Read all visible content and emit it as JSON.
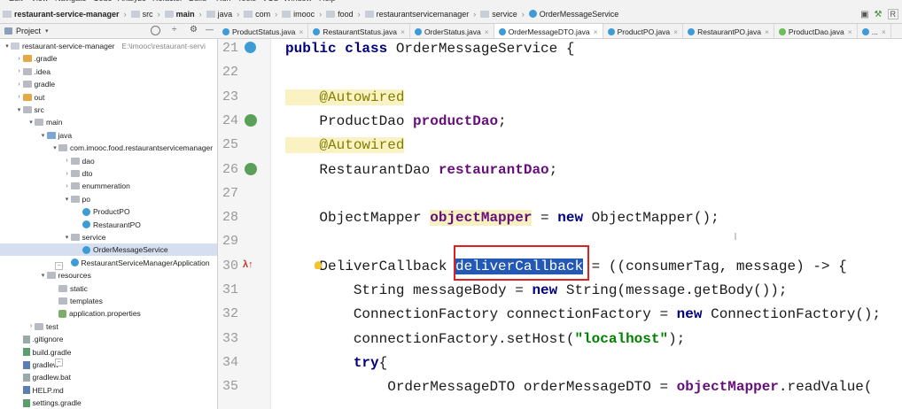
{
  "menubar": {
    "items": [
      "Edit",
      "View",
      "Navigate",
      "Code",
      "Analyze",
      "Refactor",
      "Build",
      "Run",
      "Tools",
      "VCS",
      "Window",
      "Help"
    ]
  },
  "breadcrumb": {
    "items": [
      {
        "label": "restaurant-service-manager",
        "bold": true,
        "icon": "folder"
      },
      {
        "label": "src",
        "bold": false,
        "icon": "folder"
      },
      {
        "label": "main",
        "bold": true,
        "icon": "folder"
      },
      {
        "label": "java",
        "bold": false,
        "icon": "folder"
      },
      {
        "label": "com",
        "bold": false,
        "icon": "folder"
      },
      {
        "label": "imooc",
        "bold": false,
        "icon": "folder"
      },
      {
        "label": "food",
        "bold": false,
        "icon": "folder"
      },
      {
        "label": "restaurantservicemanager",
        "bold": false,
        "icon": "folder"
      },
      {
        "label": "service",
        "bold": false,
        "icon": "folder"
      },
      {
        "label": "OrderMessageService",
        "bold": false,
        "icon": "class"
      }
    ],
    "right_icons": [
      "window-icon",
      "hammer-icon",
      "run-config-icon"
    ],
    "run_label": "R"
  },
  "project_panel": {
    "title": "Project",
    "icons": [
      "globe-icon",
      "collapse-icon",
      "gear-icon",
      "hide-icon"
    ],
    "collapse_glyph": "÷",
    "gear_glyph": "⚙",
    "hide_glyph": "—"
  },
  "tabs": [
    {
      "label": "ProductStatus.java",
      "icon": "class"
    },
    {
      "label": "RestaurantStatus.java",
      "icon": "class"
    },
    {
      "label": "OrderStatus.java",
      "icon": "class"
    },
    {
      "label": "OrderMessageDTO.java",
      "icon": "class"
    },
    {
      "label": "ProductPO.java",
      "icon": "class"
    },
    {
      "label": "RestaurantPO.java",
      "icon": "class"
    },
    {
      "label": "ProductDao.java",
      "icon": "interface"
    },
    {
      "label": "...",
      "icon": "class"
    }
  ],
  "tree": [
    {
      "label": "restaurant-service-manager",
      "hint": "E:\\imooc\\restaurant-servi",
      "depth": 0,
      "arrow": "▾",
      "icon": "folder"
    },
    {
      "label": ".gradle",
      "depth": 1,
      "arrow": "›",
      "icon": "folder-orange"
    },
    {
      "label": ".idea",
      "depth": 1,
      "arrow": "›",
      "icon": "folder-gray"
    },
    {
      "label": "gradle",
      "depth": 1,
      "arrow": "›",
      "icon": "folder-gray"
    },
    {
      "label": "out",
      "depth": 1,
      "arrow": "›",
      "icon": "folder-orange"
    },
    {
      "label": "src",
      "depth": 1,
      "arrow": "▾",
      "icon": "folder-gray"
    },
    {
      "label": "main",
      "depth": 2,
      "arrow": "▾",
      "icon": "folder-gray"
    },
    {
      "label": "java",
      "depth": 3,
      "arrow": "▾",
      "icon": "folder-src"
    },
    {
      "label": "com.imooc.food.restaurantservicemanager",
      "depth": 4,
      "arrow": "▾",
      "icon": "folder-gray"
    },
    {
      "label": "dao",
      "depth": 5,
      "arrow": "›",
      "icon": "folder-gray"
    },
    {
      "label": "dto",
      "depth": 5,
      "arrow": "›",
      "icon": "folder-gray"
    },
    {
      "label": "enummeration",
      "depth": 5,
      "arrow": "›",
      "icon": "folder-gray"
    },
    {
      "label": "po",
      "depth": 5,
      "arrow": "▾",
      "icon": "folder-gray"
    },
    {
      "label": "ProductPO",
      "depth": 6,
      "arrow": "",
      "icon": "class"
    },
    {
      "label": "RestaurantPO",
      "depth": 6,
      "arrow": "",
      "icon": "class"
    },
    {
      "label": "service",
      "depth": 5,
      "arrow": "▾",
      "icon": "folder-gray"
    },
    {
      "label": "OrderMessageService",
      "depth": 6,
      "arrow": "",
      "icon": "class",
      "selected": true
    },
    {
      "label": "RestaurantServiceManagerApplication",
      "depth": 5,
      "arrow": "",
      "icon": "class"
    },
    {
      "label": "resources",
      "depth": 3,
      "arrow": "▾",
      "icon": "folder-gray"
    },
    {
      "label": "static",
      "depth": 4,
      "arrow": "",
      "icon": "folder-gray"
    },
    {
      "label": "templates",
      "depth": 4,
      "arrow": "",
      "icon": "folder-gray"
    },
    {
      "label": "application.properties",
      "depth": 4,
      "arrow": "",
      "icon": "properties"
    },
    {
      "label": "test",
      "depth": 2,
      "arrow": "›",
      "icon": "folder-gray"
    },
    {
      "label": ".gitignore",
      "depth": 1,
      "arrow": "",
      "icon": "file"
    },
    {
      "label": "build.gradle",
      "depth": 1,
      "arrow": "",
      "icon": "file-gradle"
    },
    {
      "label": "gradlew",
      "depth": 1,
      "arrow": "",
      "icon": "file-md"
    },
    {
      "label": "gradlew.bat",
      "depth": 1,
      "arrow": "",
      "icon": "file"
    },
    {
      "label": "HELP.md",
      "depth": 1,
      "arrow": "",
      "icon": "file-md"
    },
    {
      "label": "settings.gradle",
      "depth": 1,
      "arrow": "",
      "icon": "file-gradle"
    }
  ],
  "editor": {
    "line_numbers": [
      "21",
      "22",
      "23",
      "24",
      "25",
      "26",
      "27",
      "28",
      "29",
      "30",
      "31",
      "32",
      "33",
      "34",
      "35"
    ],
    "gutter_markers": [
      {
        "line": "21",
        "icon": "class-icon"
      },
      {
        "line": "24",
        "icon": "bean-navigation-icon"
      },
      {
        "line": "26",
        "icon": "bean-navigation-icon"
      },
      {
        "line": "30",
        "icon": "lambda-icon"
      }
    ],
    "lambda_glyph": "λ↑",
    "lines": [
      [
        {
          "t": "public class ",
          "c": "kw"
        },
        {
          "t": "OrderMessageService {",
          "c": ""
        }
      ],
      [],
      [
        {
          "t": "    @Autowired",
          "c": "ann"
        }
      ],
      [
        {
          "t": "    ProductDao ",
          "c": ""
        },
        {
          "t": "productDao",
          "c": "field"
        },
        {
          "t": ";",
          "c": ""
        }
      ],
      [
        {
          "t": "    @Autowired",
          "c": "ann"
        }
      ],
      [
        {
          "t": "    RestaurantDao ",
          "c": ""
        },
        {
          "t": "restaurantDao",
          "c": "field"
        },
        {
          "t": ";",
          "c": ""
        }
      ],
      [],
      [
        {
          "t": "    ObjectMapper ",
          "c": ""
        },
        {
          "t": "objectMapper",
          "c": "field hl"
        },
        {
          "t": " = ",
          "c": ""
        },
        {
          "t": "new",
          "c": "kw"
        },
        {
          "t": " ObjectMapper();",
          "c": ""
        }
      ],
      [],
      [
        {
          "t": "    DeliverCallback ",
          "c": ""
        },
        {
          "t": "deliverCallback",
          "c": "sel"
        },
        {
          "t": " = ((consumerTag, message) -> {",
          "c": ""
        }
      ],
      [
        {
          "t": "        String messageBody = ",
          "c": ""
        },
        {
          "t": "new",
          "c": "kw"
        },
        {
          "t": " String(message.getBody());",
          "c": ""
        }
      ],
      [
        {
          "t": "        ConnectionFactory connectionFactory = ",
          "c": ""
        },
        {
          "t": "new",
          "c": "kw"
        },
        {
          "t": " ConnectionFactory();",
          "c": ""
        }
      ],
      [
        {
          "t": "        connectionFactory.setHost(",
          "c": ""
        },
        {
          "t": "\"localhost\"",
          "c": "str"
        },
        {
          "t": ");",
          "c": ""
        }
      ],
      [
        {
          "t": "        ",
          "c": ""
        },
        {
          "t": "try",
          "c": "kw"
        },
        {
          "t": "{",
          "c": ""
        }
      ],
      [
        {
          "t": "            OrderMessageDTO orderMessageDTO = ",
          "c": ""
        },
        {
          "t": "objectMapper",
          "c": "field"
        },
        {
          "t": ".readValue(",
          "c": ""
        }
      ]
    ]
  }
}
